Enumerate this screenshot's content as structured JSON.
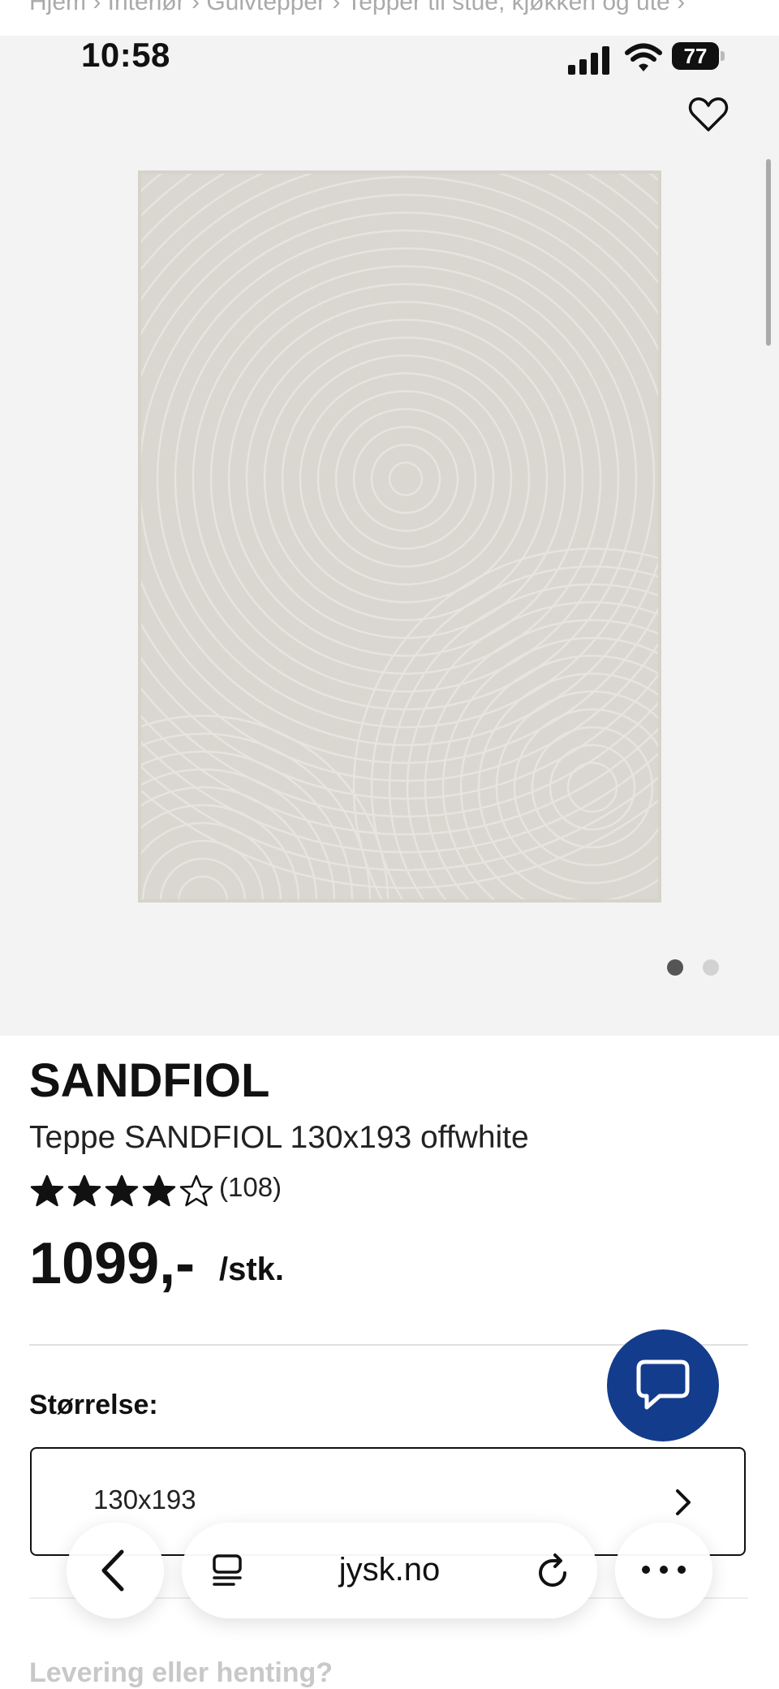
{
  "browser": {
    "breadcrumb": "Hjem  ›  Interiør  ›  Gulvtepper  ›  Tepper til stue, kjøkken og ute  ›",
    "time": "10:58",
    "battery": "77",
    "url": "jysk.no"
  },
  "icons": {
    "favorite": "heart-outline-icon",
    "chat": "chat-bubble-icon",
    "back": "chevron-left-icon",
    "tabs": "tabs-icon",
    "reload": "reload-icon",
    "more": "more-horizontal-icon"
  },
  "product": {
    "brand": "SANDFIOL",
    "subtitle": "Teppe SANDFIOL 130x193 offwhite",
    "rating": 4,
    "rating_max": 5,
    "reviews": "(108)",
    "price": "1099,-",
    "unit": "/stk.",
    "image_index": 1,
    "image_count": 2
  },
  "size": {
    "label": "Størrelse:",
    "value": "130x193"
  },
  "delivery": {
    "heading": "Levering eller henting?"
  },
  "colors": {
    "accent": "#143c8c",
    "hero_bg": "#f3f3f3",
    "rug": "#d8d6cf"
  }
}
